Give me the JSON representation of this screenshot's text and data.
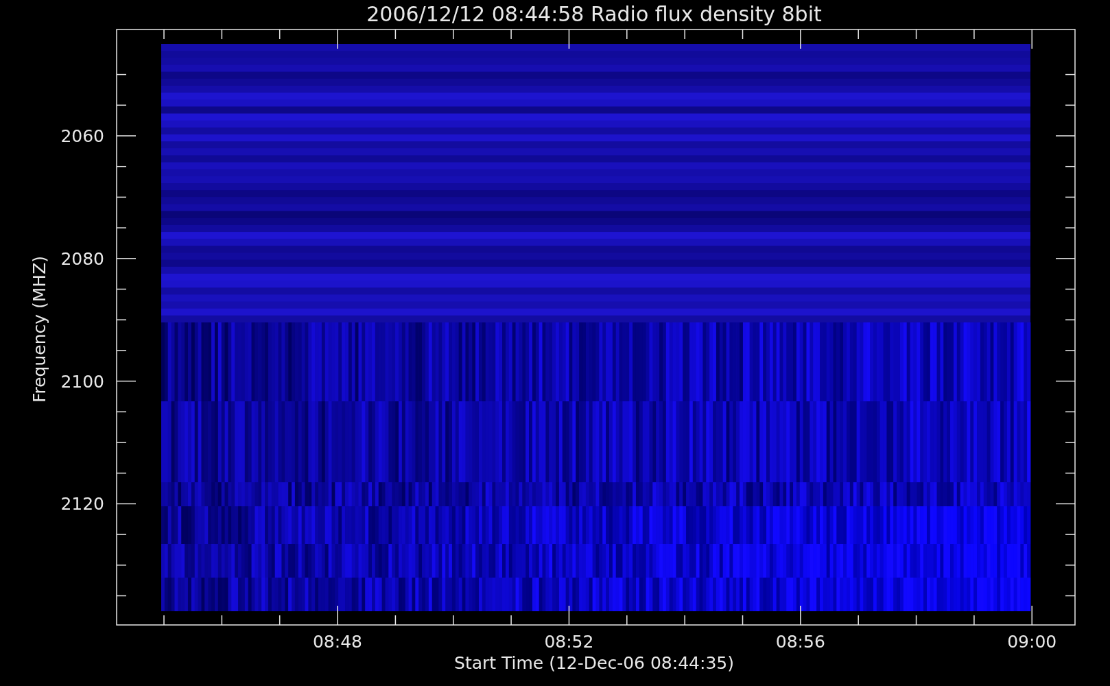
{
  "plot": {
    "title": "2006/12/12 08:44:58 Radio flux density 8bit",
    "ylabel": "Frequency (MHZ)",
    "xlabel": "Start Time (12-Dec-06 08:44:35)",
    "yticks": [
      "2060",
      "2080",
      "2100",
      "2120"
    ],
    "xticks": [
      "08:48",
      "08:52",
      "08:56",
      "09:00"
    ]
  }
}
